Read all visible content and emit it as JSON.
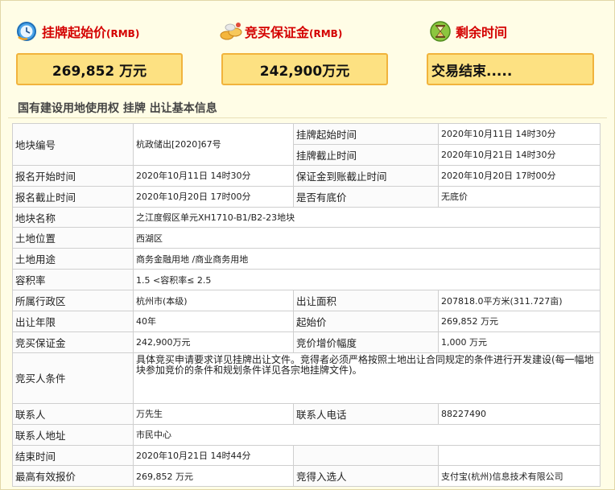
{
  "header": {
    "start_price_label": "挂牌起始价",
    "start_price_unit": "(RMB)",
    "deposit_label": "竞买保证金",
    "deposit_unit": "(RMB)",
    "remaining_label": "剩余时间",
    "start_price_value": "269,852 万元",
    "deposit_value": "242,900万元",
    "remaining_value": "交易结束....."
  },
  "section_title": "国有建设用地使用权 挂牌 出让基本信息",
  "table": {
    "r1": {
      "k1": "地块编号",
      "v1": "杭政储出[2020]67号",
      "k2a": "挂牌起始时间",
      "v2a": "2020年10月11日 14时30分",
      "k2b": "挂牌截止时间",
      "v2b": "2020年10月21日 14时30分"
    },
    "r2": {
      "k1": "报名开始时间",
      "v1": "2020年10月11日 14时30分",
      "k2": "保证金到账截止时间",
      "v2": "2020年10月20日 17时00分"
    },
    "r3": {
      "k1": "报名截止时间",
      "v1": "2020年10月20日 17时00分",
      "k2": "是否有底价",
      "v2": "无底价"
    },
    "r4": {
      "k1": "地块名称",
      "v1": "之江度假区单元XH1710-B1/B2-23地块"
    },
    "r5": {
      "k1": "土地位置",
      "v1": "西湖区"
    },
    "r6": {
      "k1": "土地用途",
      "v1": "商务金融用地 /商业商务用地"
    },
    "r7": {
      "k1": "容积率",
      "v1": "1.5 <容积率≤ 2.5"
    },
    "r8": {
      "k1": "所属行政区",
      "v1": "杭州市(本级)",
      "k2": "出让面积",
      "v2": "207818.0平方米(311.727亩)"
    },
    "r9": {
      "k1": "出让年限",
      "v1": "40年",
      "k2": "起始价",
      "v2": "269,852 万元"
    },
    "r10": {
      "k1": "竞买保证金",
      "v1": "242,900万元",
      "k2": "竞价增价幅度",
      "v2": "1,000 万元"
    },
    "r11": {
      "k1": "竞买人条件",
      "v1": "具体竞买申请要求详见挂牌出让文件。竞得者必须严格按照土地出让合同规定的条件进行开发建设(每一幅地块参加竞价的条件和规划条件详见各宗地挂牌文件)。"
    },
    "r12": {
      "k1": "联系人",
      "v1": "万先生",
      "k2": "联系人电话",
      "v2": "88227490"
    },
    "r13": {
      "k1": "联系人地址",
      "v1": "市民中心"
    },
    "r14": {
      "k1": "结束时间",
      "v1": "2020年10月21日 14时44分"
    },
    "r15": {
      "k1": "最高有效报价",
      "v1": "269,852 万元",
      "k2": "竞得入选人",
      "v2": "支付宝(杭州)信息技术有限公司"
    }
  },
  "icons": {
    "clock": "clock-icon",
    "coins": "coins-icon",
    "hourglass": "hourglass-icon"
  },
  "colors": {
    "label_red": "#d40000",
    "box_fill": "#fde182",
    "box_border": "#f1b33c",
    "background": "#fffde6"
  }
}
